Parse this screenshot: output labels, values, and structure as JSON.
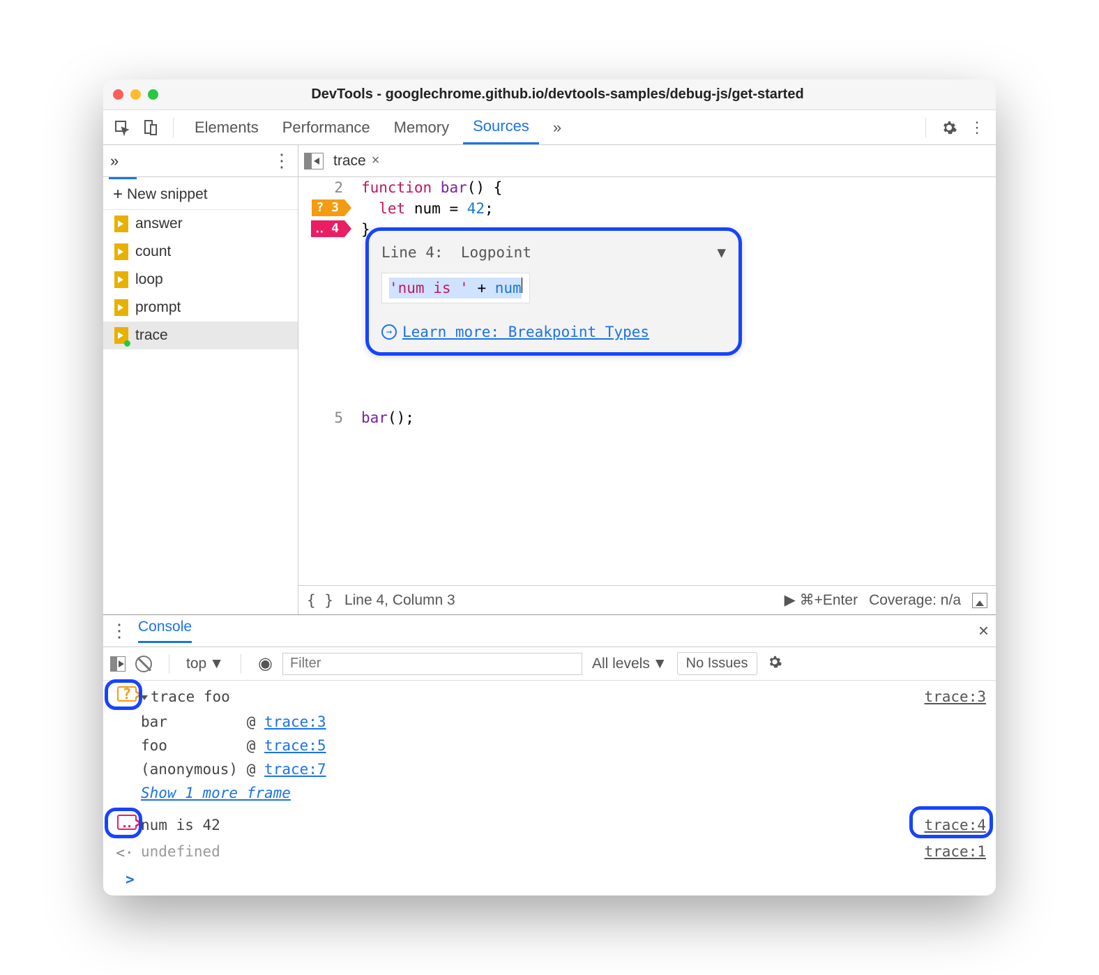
{
  "title": "DevTools - googlechrome.github.io/devtools-samples/debug-js/get-started",
  "tabs": {
    "elements": "Elements",
    "performance": "Performance",
    "memory": "Memory",
    "sources": "Sources",
    "more": "»"
  },
  "sidebar": {
    "overflow": "»",
    "newSnippet": "New snippet",
    "files": [
      "answer",
      "count",
      "loop",
      "prompt",
      "trace"
    ],
    "selected": "trace"
  },
  "editor": {
    "tabName": "trace",
    "lines": {
      "l2": "2",
      "l3": "3",
      "l4": "4",
      "l5": "5",
      "c2a": "function ",
      "c2b": "bar",
      "c2c": "() {",
      "c3a": "  let ",
      "c3b": "num",
      "c3c": " = ",
      "c3d": "42",
      "c3e": ";",
      "c4": "}",
      "c5a": "bar",
      "c5b": "();"
    },
    "bp3": "?",
    "bp4": "‥",
    "popup": {
      "line": "Line 4:",
      "type": "Logpoint",
      "exprA": "'num is '",
      "exprB": " + ",
      "exprC": "num",
      "learn": "Learn more: Breakpoint Types"
    },
    "status": {
      "pos": "Line 4, Column 3",
      "run": "▶ ⌘+Enter",
      "coverage": "Coverage: n/a"
    }
  },
  "console": {
    "tab": "Console",
    "context": "top",
    "filterPlaceholder": "Filter",
    "levels": "All levels",
    "issues": "No Issues",
    "row1": {
      "msg": "trace foo",
      "src": "trace:3"
    },
    "stack": [
      {
        "fn": "bar",
        "at": "@",
        "loc": "trace:3"
      },
      {
        "fn": "foo",
        "at": "@",
        "loc": "trace:5"
      },
      {
        "fn": "(anonymous)",
        "at": "@",
        "loc": "trace:7"
      }
    ],
    "showMore": "Show 1 more frame",
    "row2": {
      "msg": "num is 42",
      "src": "trace:4"
    },
    "row3": {
      "msg": "undefined",
      "src": "trace:1"
    }
  }
}
